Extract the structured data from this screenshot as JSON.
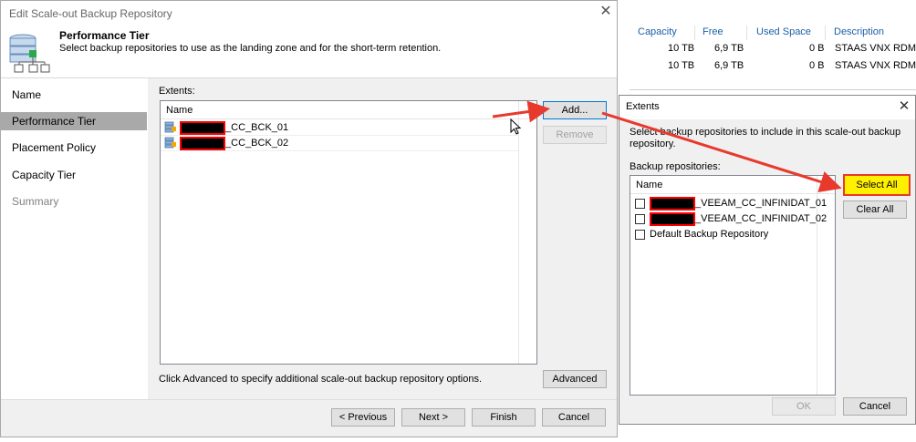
{
  "main_dialog": {
    "title": "Edit Scale-out Backup Repository",
    "close_glyph": "✕",
    "header": {
      "title": "Performance Tier",
      "description": "Select backup repositories to use as the landing zone and for the short-term retention."
    },
    "nav": [
      "Name",
      "Performance Tier",
      "Placement Policy",
      "Capacity Tier",
      "Summary"
    ],
    "active_nav": "Performance Tier",
    "extents_label": "Extents:",
    "list_header": "Name",
    "extents": [
      {
        "name": "_CC_BCK_01"
      },
      {
        "name": "_CC_BCK_02"
      }
    ],
    "add_label": "Add...",
    "remove_label": "Remove",
    "advanced_hint": "Click Advanced to specify additional scale-out backup repository options.",
    "advanced_label": "Advanced",
    "previous_label": "< Previous",
    "next_label": "Next >",
    "finish_label": "Finish",
    "cancel_label": "Cancel"
  },
  "bg_table": {
    "columns": [
      "Capacity",
      "Free",
      "Used Space",
      "Description"
    ],
    "rows": [
      {
        "capacity": "10 TB",
        "free": "6,9 TB",
        "used": "0 B",
        "description": "STAAS VNX RDM L"
      },
      {
        "capacity": "10 TB",
        "free": "6,9 TB",
        "used": "0 B",
        "description": "STAAS VNX RDM L"
      }
    ]
  },
  "extents_dialog": {
    "title": "Extents",
    "close_glyph": "✕",
    "instruction": "Select backup repositories to include in this scale-out backup repository.",
    "repos_label": "Backup repositories:",
    "list_header": "Name",
    "repos": [
      {
        "name": "_VEEAM_CC_INFINIDAT_01",
        "redacted_prefix": true
      },
      {
        "name": "_VEEAM_CC_INFINIDAT_02",
        "redacted_prefix": true
      },
      {
        "name": "Default Backup Repository",
        "redacted_prefix": false
      }
    ],
    "select_all_label": "Select All",
    "clear_all_label": "Clear All",
    "ok_label": "OK",
    "cancel_label": "Cancel"
  },
  "colors": {
    "annotation_arrow": "#e8392d",
    "select_all_highlight": "#fff000",
    "active_nav_bg": "#a9a9a9",
    "column_header_text": "#1a5fa8"
  }
}
